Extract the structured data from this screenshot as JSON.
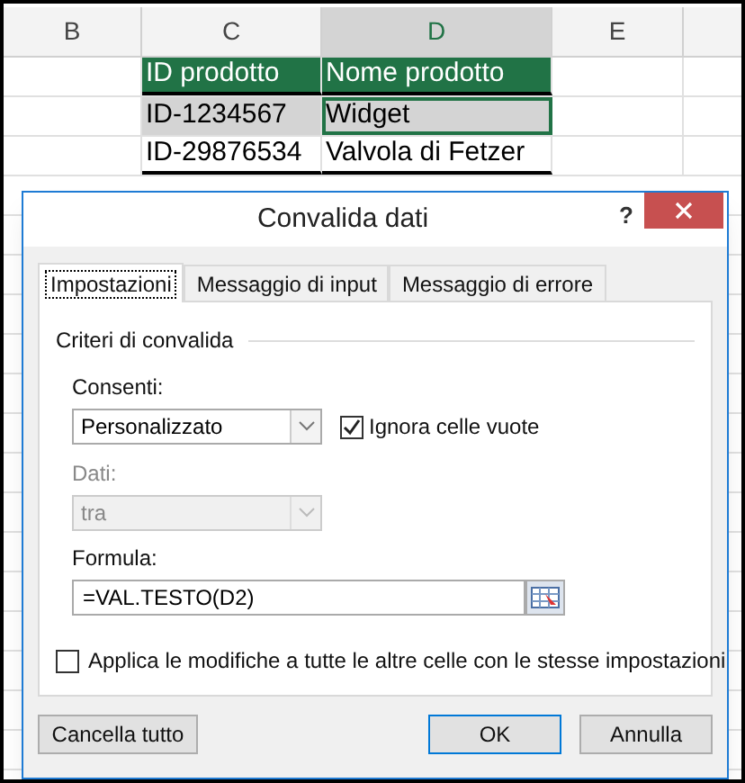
{
  "sheet": {
    "columns": [
      {
        "label": "B",
        "selected": false
      },
      {
        "label": "C",
        "selected": false
      },
      {
        "label": "D",
        "selected": true
      },
      {
        "label": "E",
        "selected": false
      }
    ],
    "rows": [
      {
        "cells": [
          {
            "text": "",
            "kind": "empty"
          },
          {
            "text": "ID prodotto",
            "kind": "header"
          },
          {
            "text": "Nome prodotto",
            "kind": "header"
          },
          {
            "text": "",
            "kind": "empty"
          }
        ]
      },
      {
        "cells": [
          {
            "text": "",
            "kind": "empty"
          },
          {
            "text": "ID-1234567",
            "kind": "data",
            "highlighted": true,
            "active": false
          },
          {
            "text": "Widget",
            "kind": "data",
            "highlighted": true,
            "active": true
          },
          {
            "text": "",
            "kind": "empty"
          }
        ]
      },
      {
        "cells": [
          {
            "text": "",
            "kind": "empty"
          },
          {
            "text": "ID-29876534",
            "kind": "data",
            "highlighted": false,
            "active": false
          },
          {
            "text": "Valvola di Fetzer",
            "kind": "data",
            "highlighted": false,
            "active": false
          },
          {
            "text": "",
            "kind": "empty"
          }
        ]
      }
    ]
  },
  "dialog": {
    "title": "Convalida dati",
    "help": "?",
    "tabs": [
      {
        "label": "Impostazioni",
        "selected": true
      },
      {
        "label": "Messaggio di input",
        "selected": false
      },
      {
        "label": "Messaggio di errore",
        "selected": false
      }
    ],
    "group_title": "Criteri di convalida",
    "allow": {
      "label": "Consenti:",
      "value": "Personalizzato",
      "disabled": false
    },
    "ignore_blank": {
      "label": "Ignora celle vuote",
      "checked": true
    },
    "data": {
      "label": "Dati:",
      "value": "tra",
      "disabled": true
    },
    "formula": {
      "label": "Formula:",
      "value": "=VAL.TESTO(D2)"
    },
    "apply_all": {
      "label": "Applica le modifiche a tutte le altre celle con le stesse impostazioni",
      "checked": false
    },
    "buttons": [
      {
        "label": "Cancella tutto",
        "default": false
      },
      {
        "label": "OK",
        "default": true
      },
      {
        "label": "Annulla",
        "default": false
      }
    ]
  }
}
